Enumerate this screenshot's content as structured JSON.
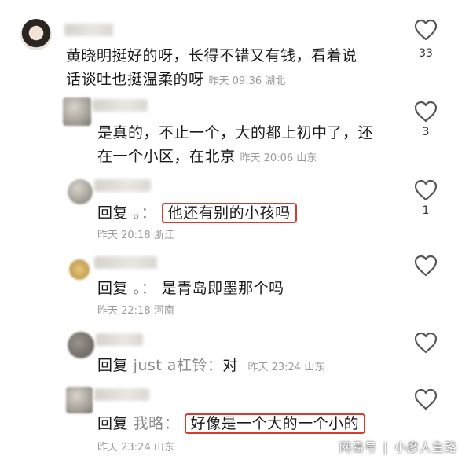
{
  "comments": [
    {
      "text_line1": "黄晓明挺好的呀，长得不错又有钱，看着说",
      "text_line2": "话谈吐也挺温柔的呀",
      "time": "昨天 09:36",
      "location": "湖北",
      "likes": "33"
    },
    {
      "text_line1": "是真的，不止一个，大的都上初中了，还",
      "text_line2": "在一个小区，在北京",
      "time": "昨天 20:06",
      "location": "山东",
      "likes": "3"
    },
    {
      "reply_label": "回复",
      "target": "。：",
      "text": "他还有别的小孩吗",
      "time": "昨天 20:18",
      "location": "浙江",
      "likes": "1"
    },
    {
      "reply_label": "回复",
      "target": "。：",
      "text": "是青岛即墨那个吗",
      "time": "昨天 22:18",
      "location": "河南",
      "likes": ""
    },
    {
      "reply_label": "回复",
      "target": "just a杠铃：",
      "text": "对",
      "time": "昨天 23:24",
      "location": "山东",
      "likes": ""
    },
    {
      "reply_label": "回复",
      "target": "我略：",
      "text": "好像是一个大的一个小的",
      "time": "昨天 23:24",
      "location": "山东",
      "likes": ""
    }
  ],
  "icons": {
    "like": "heart-outline-icon"
  },
  "colors": {
    "highlight_box": "#d83a2e",
    "meta_gray": "#9a9a9a"
  },
  "footer": {
    "brand": "网易号",
    "author": "小彦人生路"
  }
}
